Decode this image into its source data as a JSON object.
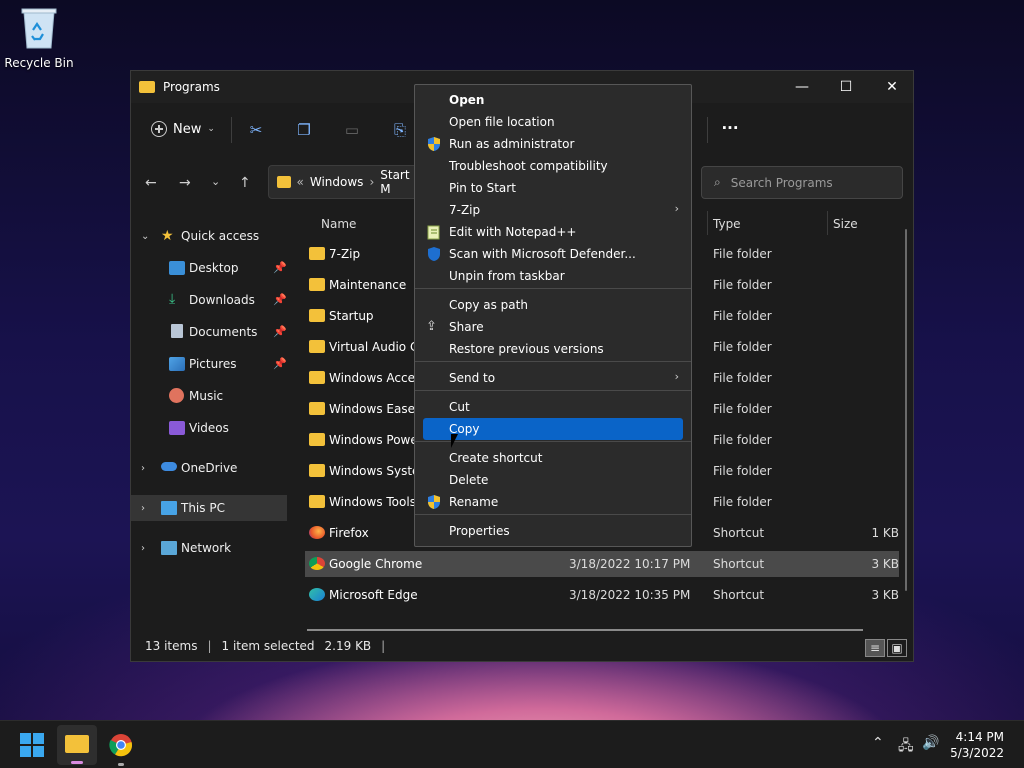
{
  "desktop": {
    "recycle_bin_label": "Recycle Bin"
  },
  "window": {
    "title": "Programs",
    "controls": {
      "minimize": "—",
      "maximize": "☐",
      "close": "✕"
    }
  },
  "commandbar": {
    "new_label": "New",
    "more_label": "···"
  },
  "address": {
    "crumbs": [
      "«",
      "Windows",
      "›",
      "Start M"
    ]
  },
  "search": {
    "placeholder": "Search Programs"
  },
  "nav": {
    "quick_access": "Quick access",
    "items": [
      {
        "label": "Desktop",
        "pinned": true
      },
      {
        "label": "Downloads",
        "pinned": true
      },
      {
        "label": "Documents",
        "pinned": true
      },
      {
        "label": "Pictures",
        "pinned": true
      },
      {
        "label": "Music",
        "pinned": false
      },
      {
        "label": "Videos",
        "pinned": false
      }
    ],
    "onedrive": "OneDrive",
    "thispc": "This PC",
    "network": "Network"
  },
  "columns": {
    "name": "Name",
    "type": "Type",
    "size": "Size"
  },
  "rows": [
    {
      "name": "7-Zip",
      "date": "",
      "type": "File folder",
      "size": "",
      "kind": "folder"
    },
    {
      "name": "Maintenance",
      "date": "",
      "type": "File folder",
      "size": "",
      "kind": "folder"
    },
    {
      "name": "Startup",
      "date": "",
      "type": "File folder",
      "size": "",
      "kind": "folder"
    },
    {
      "name": "Virtual Audio Ca",
      "date": "",
      "type": "File folder",
      "size": "",
      "kind": "folder"
    },
    {
      "name": "Windows Access",
      "date": "",
      "type": "File folder",
      "size": "",
      "kind": "folder"
    },
    {
      "name": "Windows Ease of",
      "date": "",
      "type": "File folder",
      "size": "",
      "kind": "folder"
    },
    {
      "name": "Windows Power",
      "date": "",
      "type": "File folder",
      "size": "",
      "kind": "folder"
    },
    {
      "name": "Windows System",
      "date": "",
      "type": "File folder",
      "size": "",
      "kind": "folder"
    },
    {
      "name": "Windows Tools",
      "date": "",
      "type": "File folder",
      "size": "",
      "kind": "folder"
    },
    {
      "name": "Firefox",
      "date": "",
      "type": "Shortcut",
      "size": "1 KB",
      "kind": "firefox"
    },
    {
      "name": "Google Chrome",
      "date": "3/18/2022 10:17 PM",
      "type": "Shortcut",
      "size": "3 KB",
      "kind": "chrome",
      "selected": true
    },
    {
      "name": "Microsoft Edge",
      "date": "3/18/2022 10:35 PM",
      "type": "Shortcut",
      "size": "3 KB",
      "kind": "edge"
    }
  ],
  "status": {
    "items": "13 items",
    "selected": "1 item selected",
    "size": "2.19 KB"
  },
  "context_menu": {
    "items": [
      {
        "label": "Open",
        "bold": true
      },
      {
        "label": "Open file location"
      },
      {
        "label": "Run as administrator",
        "icon": "shield"
      },
      {
        "label": "Troubleshoot compatibility"
      },
      {
        "label": "Pin to Start"
      },
      {
        "label": "7-Zip",
        "submenu": true
      },
      {
        "label": "Edit with Notepad++",
        "icon": "notepad"
      },
      {
        "label": "Scan with Microsoft Defender...",
        "icon": "defender"
      },
      {
        "label": "Unpin from taskbar"
      },
      {
        "label": "Copy as path"
      },
      {
        "label": "Share",
        "icon": "share"
      },
      {
        "label": "Restore previous versions"
      },
      {
        "label": "Send to",
        "submenu": true
      },
      {
        "label": "Cut"
      },
      {
        "label": "Copy",
        "highlighted": true
      },
      {
        "label": "Create shortcut"
      },
      {
        "label": "Delete"
      },
      {
        "label": "Rename",
        "icon": "shield"
      },
      {
        "label": "Properties"
      }
    ]
  },
  "taskbar": {
    "time": "4:14 PM",
    "date": "5/3/2022"
  },
  "colors": {
    "accent": "#0a64c8",
    "folder": "#f3c13a"
  }
}
